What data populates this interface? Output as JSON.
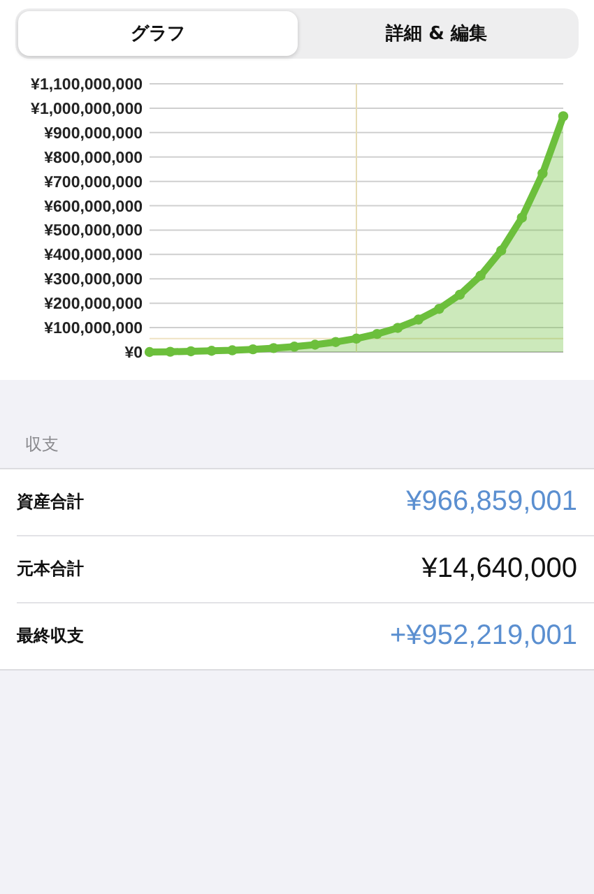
{
  "tabs": [
    {
      "label": "グラフ",
      "selected": true
    },
    {
      "label": "詳細 & 編集",
      "selected": false
    }
  ],
  "chart": {
    "chart_data": {
      "type": "area",
      "yticks": [
        {
          "value": 0,
          "label": "¥0"
        },
        {
          "value": 100000000,
          "label": "¥100,000,000"
        },
        {
          "value": 200000000,
          "label": "¥200,000,000"
        },
        {
          "value": 300000000,
          "label": "¥300,000,000"
        },
        {
          "value": 400000000,
          "label": "¥400,000,000"
        },
        {
          "value": 500000000,
          "label": "¥500,000,000"
        },
        {
          "value": 600000000,
          "label": "¥600,000,000"
        },
        {
          "value": 700000000,
          "label": "¥700,000,000"
        },
        {
          "value": 800000000,
          "label": "¥800,000,000"
        },
        {
          "value": 900000000,
          "label": "¥900,000,000"
        },
        {
          "value": 1000000000,
          "label": "¥1,000,000,000"
        },
        {
          "value": 1100000000,
          "label": "¥1,100,000,000"
        }
      ],
      "ylim": [
        0,
        1100000000
      ],
      "grid": true,
      "series": [
        {
          "color": "#6cbf3c",
          "marker": true,
          "values": [
            0,
            1000000,
            3000000,
            5000000,
            7000000,
            11000000,
            16000000,
            22000000,
            30000000,
            41000000,
            55000000,
            74000000,
            99000000,
            133000000,
            177000000,
            235000000,
            313000000,
            416000000,
            551000000,
            732000000,
            967000000
          ]
        }
      ],
      "ref_lines": [
        {
          "axis": "y",
          "value": 55000000
        }
      ]
    }
  },
  "section": {
    "header": "収支",
    "rows": [
      {
        "label": "資産合計",
        "value": "¥966,859,001",
        "kind": "accent"
      },
      {
        "label": "元本合計",
        "value": "¥14,640,000",
        "kind": "plain"
      },
      {
        "label": "最終収支",
        "value": "+¥952,219,001",
        "kind": "accent"
      }
    ]
  }
}
